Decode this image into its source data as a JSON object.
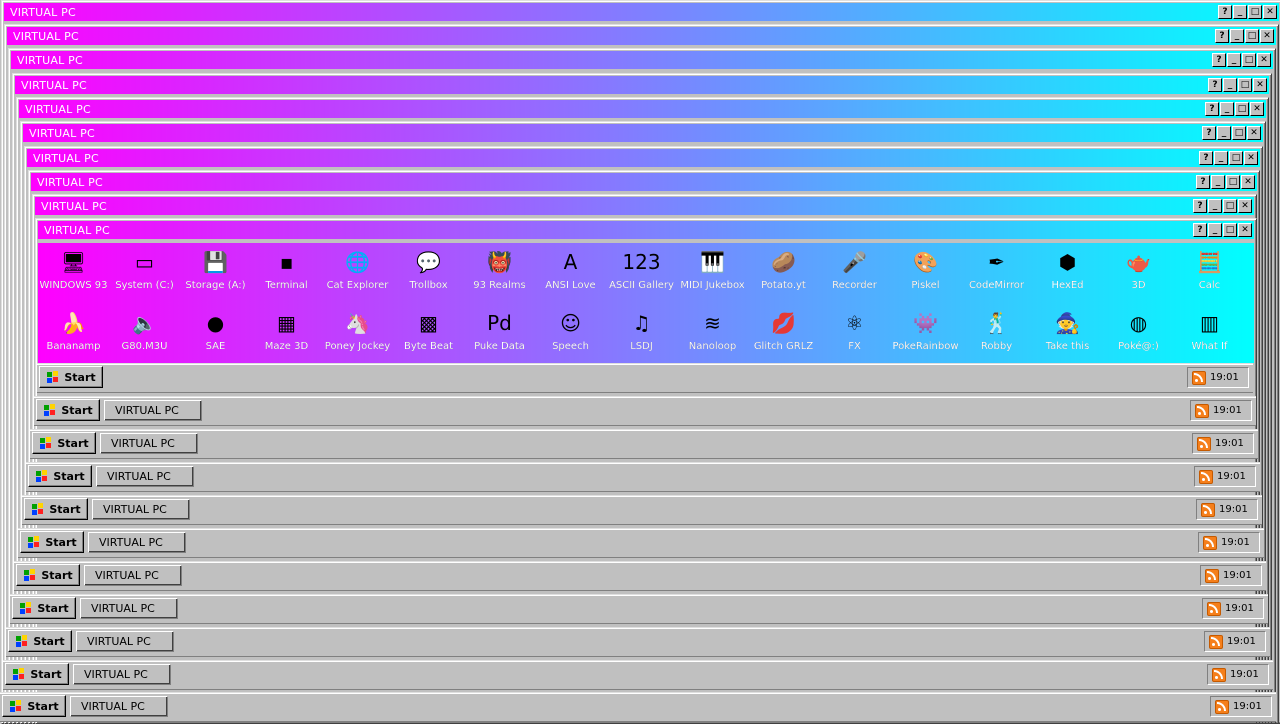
{
  "window_title": "VIRTUAL PC",
  "title_buttons": [
    "?",
    "_",
    "□",
    "✕"
  ],
  "colors": {
    "title_start": "#ff00ff",
    "title_end": "#00ffff",
    "desktop_bg": "#c0c0c0"
  },
  "desktop_icons": [
    {
      "label": "WINDOWS 93",
      "icon": "computer-icon",
      "glyph": "🖥"
    },
    {
      "label": "System (C:)",
      "icon": "drive-icon",
      "glyph": "▭"
    },
    {
      "label": "Storage (A:)",
      "icon": "floppy-drive-icon",
      "glyph": "💾"
    },
    {
      "label": "Terminal",
      "icon": "terminal-icon",
      "glyph": "▪"
    },
    {
      "label": "Cat Explorer",
      "icon": "globe-cat-icon",
      "glyph": "🌐"
    },
    {
      "label": "Trollbox",
      "icon": "chat-bubble-icon",
      "glyph": "💬"
    },
    {
      "label": "93 Realms",
      "icon": "red-creature-icon",
      "glyph": "👹"
    },
    {
      "label": "ANSI Love",
      "icon": "letter-a-icon",
      "glyph": "A"
    },
    {
      "label": "ASCII Gallery",
      "icon": "numbers-icon",
      "glyph": "123"
    },
    {
      "label": "MIDI Jukebox",
      "icon": "piano-icon",
      "glyph": "🎹"
    },
    {
      "label": "Potato.yt",
      "icon": "potato-icon",
      "glyph": "🥔"
    },
    {
      "label": "Recorder",
      "icon": "microphone-icon",
      "glyph": "🎤"
    },
    {
      "label": "Piskel",
      "icon": "palette-icon",
      "glyph": "🎨"
    },
    {
      "label": "CodeMirror",
      "icon": "code-mirror-icon",
      "glyph": "✒"
    },
    {
      "label": "HexEd",
      "icon": "hex-cube-icon",
      "glyph": "⬢"
    },
    {
      "label": "3D",
      "icon": "teapot-icon",
      "glyph": "🫖"
    },
    {
      "label": "Calc",
      "icon": "calculator-icon",
      "glyph": "🧮"
    },
    {
      "label": "Bananamp",
      "icon": "banana-icon",
      "glyph": "🍌"
    },
    {
      "label": "G80.M3U",
      "icon": "speaker-icon",
      "glyph": "🔈"
    },
    {
      "label": "SAE",
      "icon": "checker-ball-icon",
      "glyph": "●"
    },
    {
      "label": "Maze 3D",
      "icon": "maze-icon",
      "glyph": "▦"
    },
    {
      "label": "Poney Jockey",
      "icon": "pony-icon",
      "glyph": "🦄"
    },
    {
      "label": "Byte Beat",
      "icon": "bytebeat-icon",
      "glyph": "▩"
    },
    {
      "label": "Puke Data",
      "icon": "pd-icon",
      "glyph": "Pd"
    },
    {
      "label": "Speech",
      "icon": "speech-face-icon",
      "glyph": "☺"
    },
    {
      "label": "LSDJ",
      "icon": "lsdj-icon",
      "glyph": "♫"
    },
    {
      "label": "Nanoloop",
      "icon": "waveform-icon",
      "glyph": "≋"
    },
    {
      "label": "Glitch GRLZ",
      "icon": "lips-icon",
      "glyph": "💋"
    },
    {
      "label": "FX",
      "icon": "atom-icon",
      "glyph": "⚛"
    },
    {
      "label": "PokeRainbow",
      "icon": "pokemon-icon",
      "glyph": "👾"
    },
    {
      "label": "Robby",
      "icon": "stick-figure-icon",
      "glyph": "🕺"
    },
    {
      "label": "Take this",
      "icon": "old-man-icon",
      "glyph": "🧙"
    },
    {
      "label": "Poké@:)",
      "icon": "pokeball-icon",
      "glyph": "◍"
    },
    {
      "label": "What If",
      "icon": "what-if-icon",
      "glyph": "▥"
    }
  ],
  "taskbar": {
    "start_label": "Start",
    "task_label": "VIRTUAL PC",
    "clock": "19:01"
  }
}
